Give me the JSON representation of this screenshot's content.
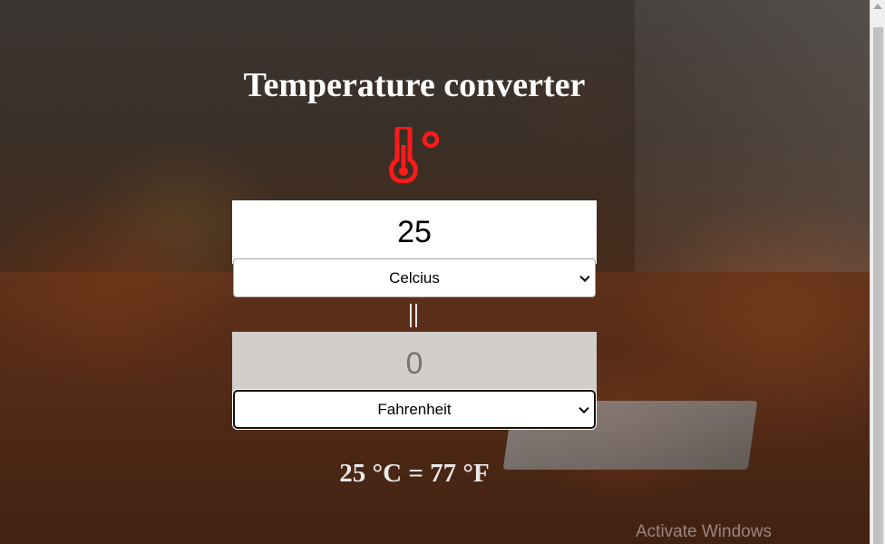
{
  "app": {
    "title": "Temperature converter"
  },
  "converter": {
    "from_value": "25",
    "from_unit": "Celcius",
    "to_value": "0",
    "to_unit": "Fahrenheit",
    "equals_symbol": "||",
    "result_text": "25 °C = 77 °F"
  },
  "icons": {
    "thermometer": "thermometer-celsius-icon",
    "select_chevron": "chevron-down-icon"
  },
  "colors": {
    "accent": "#ff1a1a",
    "title_text": "#ffffff",
    "result_text": "#e9e9e9"
  },
  "watermark": {
    "text": "Activate Windows"
  }
}
